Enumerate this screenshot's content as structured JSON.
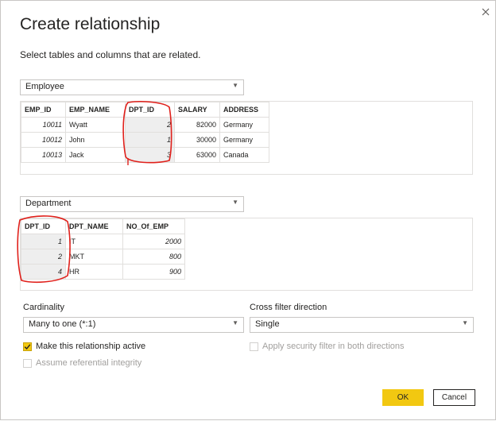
{
  "dialog": {
    "title": "Create relationship",
    "subtitle": "Select tables and columns that are related.",
    "close_icon": "close-icon"
  },
  "table1": {
    "selected": "Employee",
    "columns": [
      "EMP_ID",
      "EMP_NAME",
      "DPT_ID",
      "SALARY",
      "ADDRESS"
    ],
    "rows": [
      [
        "10011",
        "Wyatt",
        "2",
        "82000",
        "Germany"
      ],
      [
        "10012",
        "John",
        "1",
        "30000",
        "Germany"
      ],
      [
        "10013",
        "Jack",
        "3",
        "63000",
        "Canada"
      ]
    ]
  },
  "table2": {
    "selected": "Department",
    "columns": [
      "DPT_ID",
      "DPT_NAME",
      "NO_Of_EMP"
    ],
    "rows": [
      [
        "1",
        "IT",
        "2000"
      ],
      [
        "2",
        "MKT",
        "800"
      ],
      [
        "4",
        "HR",
        "900"
      ]
    ]
  },
  "cardinality": {
    "label": "Cardinality",
    "value": "Many to one (*:1)"
  },
  "cross_filter": {
    "label": "Cross filter direction",
    "value": "Single"
  },
  "options": {
    "active_label": "Make this relationship active",
    "active_checked": true,
    "security_label": "Apply security filter in both directions",
    "integrity_label": "Assume referential integrity"
  },
  "buttons": {
    "ok": "OK",
    "cancel": "Cancel"
  },
  "colors": {
    "accent": "#f2c811",
    "annotation": "#e0201b"
  }
}
